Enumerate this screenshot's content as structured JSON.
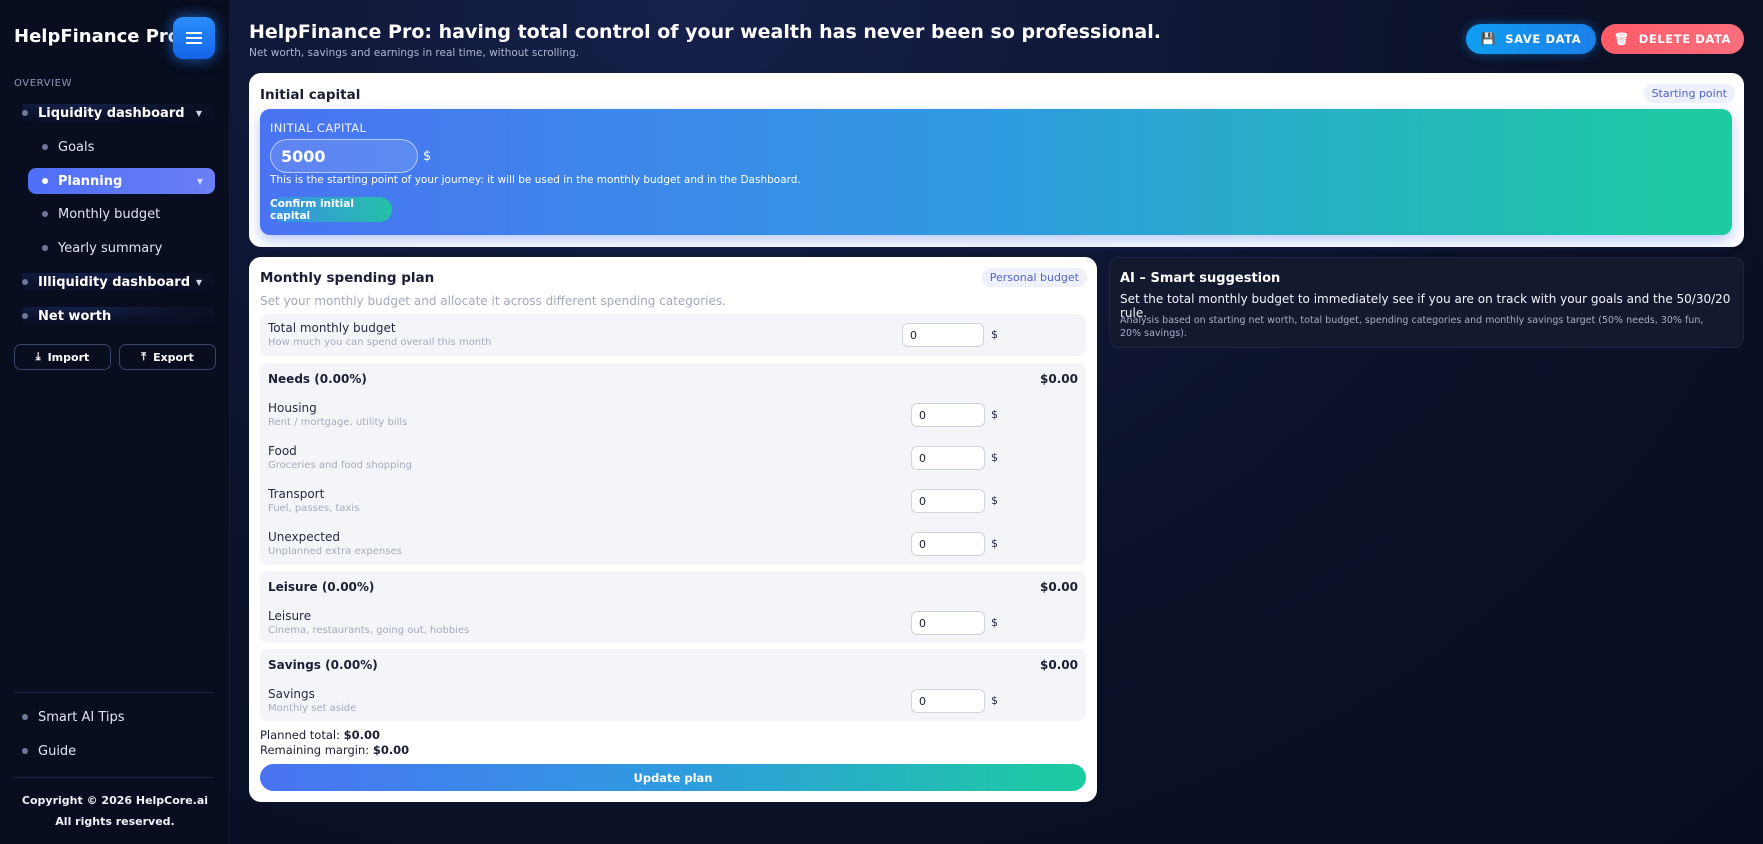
{
  "sidebar": {
    "brand": "HelpFinance Pro",
    "section_title": "OVERVIEW",
    "items": [
      {
        "label": "Liquidity dashboard",
        "caret": "▼"
      },
      {
        "label": "Goals"
      },
      {
        "label": "Planning",
        "caret": "▼"
      },
      {
        "label": "Monthly budget"
      },
      {
        "label": "Yearly summary"
      },
      {
        "label": "Illiquidity dashboard",
        "caret": "▼"
      },
      {
        "label": "Net worth"
      }
    ],
    "import_label": "Import",
    "export_label": "Export",
    "bottom_items": [
      {
        "label": "Smart AI Tips"
      },
      {
        "label": "Guide"
      }
    ],
    "copyright_line1": "Copyright © 2026 HelpCore.ai",
    "copyright_line2": "All rights reserved."
  },
  "header": {
    "title": "HelpFinance Pro: having total control of your wealth has never been so professional.",
    "subtitle": "Net worth, savings and earnings in real time, without scrolling.",
    "save_label": "SAVE DATA",
    "delete_label": "DELETE DATA"
  },
  "initial_capital": {
    "title": "Initial capital",
    "badge": "Starting point",
    "label": "INITIAL CAPITAL",
    "value": "5000",
    "currency": "$",
    "description": "This is the starting point of your journey: it will be used in the monthly budget and in the Dashboard.",
    "confirm_label": "Confirm initial capital"
  },
  "plan": {
    "title": "Monthly spending plan",
    "badge": "Personal budget",
    "subtitle": "Set your monthly budget and allocate it across different spending categories.",
    "total": {
      "label": "Total monthly budget",
      "hint": "How much you can spend overall this month",
      "value": "0",
      "currency": "$"
    },
    "needs": {
      "header": "Needs (0.00%)",
      "amount": "$0.00",
      "rows": [
        {
          "label": "Housing",
          "hint": "Rent / mortgage, utility bills",
          "value": "0",
          "currency": "$"
        },
        {
          "label": "Food",
          "hint": "Groceries and food shopping",
          "value": "0",
          "currency": "$"
        },
        {
          "label": "Transport",
          "hint": "Fuel, passes, taxis",
          "value": "0",
          "currency": "$"
        },
        {
          "label": "Unexpected",
          "hint": "Unplanned extra expenses",
          "value": "0",
          "currency": "$"
        }
      ]
    },
    "leisure": {
      "header": "Leisure (0.00%)",
      "amount": "$0.00",
      "rows": [
        {
          "label": "Leisure",
          "hint": "Cinema, restaurants, going out, hobbies",
          "value": "0",
          "currency": "$"
        }
      ]
    },
    "savings": {
      "header": "Savings (0.00%)",
      "amount": "$0.00",
      "rows": [
        {
          "label": "Savings",
          "hint": "Monthly set aside",
          "value": "0",
          "currency": "$"
        }
      ]
    },
    "planned_total_label": "Planned total:",
    "planned_total_value": "$0.00",
    "remaining_label": "Remaining margin:",
    "remaining_value": "$0.00",
    "update_label": "Update plan"
  },
  "ai": {
    "title": "AI – Smart suggestion",
    "main": "Set the total monthly budget to immediately see if you are on track with your goals and the 50/30/20 rule.",
    "note": "Analysis based on starting net worth, total budget, spending categories and monthly savings target (50% needs, 30% fun, 20% savings)."
  }
}
